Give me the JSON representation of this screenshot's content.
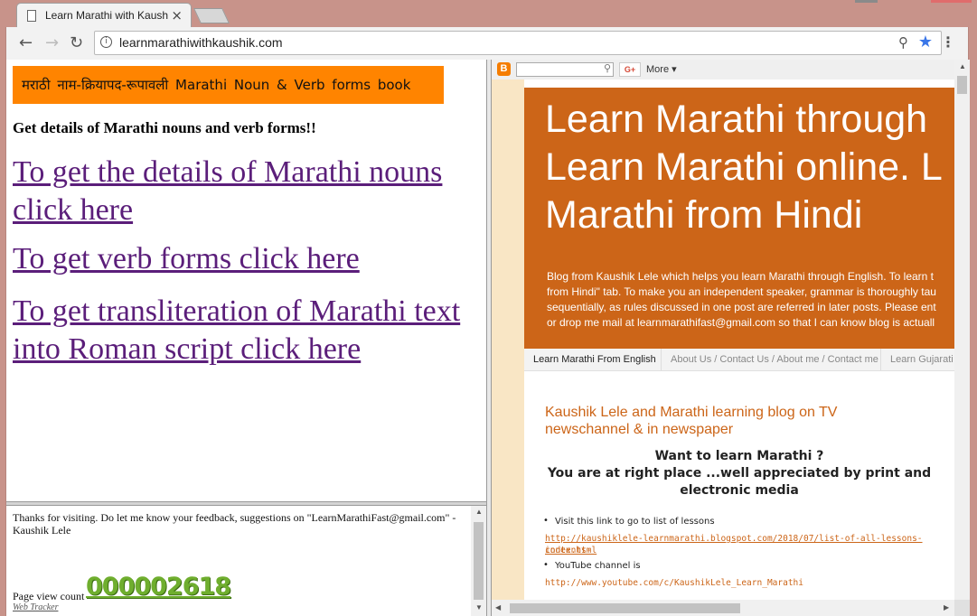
{
  "browser": {
    "tab_title": "Learn Marathi with Kaushik",
    "url": "learnmarathiwithkaushik.com"
  },
  "left_frame": {
    "banner": "मराठी नाम-क्रियापद-रूपावली Marathi Noun & Verb forms book",
    "subheading": "Get details of Marathi nouns and verb forms!!",
    "links": [
      "To get the details of Marathi nouns click here",
      "To get verb forms click here",
      "To get transliteration of Marathi text into Roman script click here"
    ]
  },
  "bottom_frame": {
    "thanks": "Thanks for visiting. Do let me know your feedback, suggestions on \"LearnMarathiFast@gmail.com\" - Kaushik Lele",
    "page_view_label": "Page view count",
    "counter": "000002618",
    "tracker": "Web Tracker"
  },
  "blog": {
    "toolbar": {
      "more": "More ▾",
      "gplus": "G+"
    },
    "title_lines": [
      "Learn Marathi through",
      "Learn Marathi online. L",
      "Marathi from Hindi"
    ],
    "description_lines": [
      "Blog from Kaushik Lele which helps you learn Marathi through English. To learn t",
      "from Hindi\" tab. To make you an independent speaker, grammar is thoroughly tau",
      "sequentially, as rules discussed in one post are referred in later posts. Please ent",
      "or drop me mail at learnmarathifast@gmail.com so that I can know blog is actuall"
    ],
    "tabs": [
      "Learn Marathi From English",
      "About Us / Contact Us / About me / Contact me",
      "Learn Gujarati"
    ],
    "post_title": "Kaushik Lele and Marathi learning blog on TV newschannel & in newspaper",
    "post_heading_1": "Want to learn Marathi ?",
    "post_heading_2": "You are at right place ...well appreciated by print and electronic media",
    "bullet_1": "Visit this link to go to list of lessons",
    "link_1a": "http://kaushiklele-learnmarathi.blogspot.com/2018/07/list-of-all-lessons-contents-",
    "link_1b": "index.html",
    "bullet_2": "YouTube channel is",
    "link_2": "http://www.youtube.com/c/KaushikLele_Learn_Marathi"
  },
  "colors": {
    "banner_orange": "#ff8400",
    "link_purple": "#5b1e7a",
    "blog_header": "#cc6518",
    "counter_green": "#6fae2e"
  }
}
